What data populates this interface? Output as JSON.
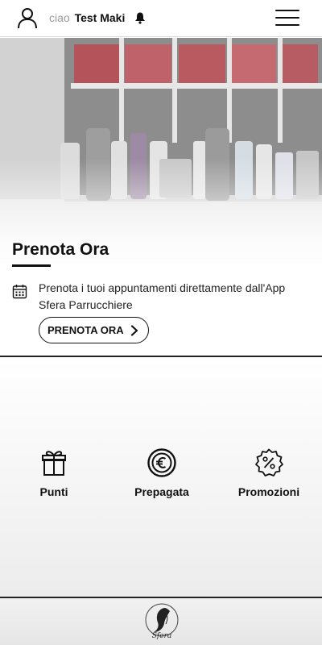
{
  "header": {
    "greeting": "ciao",
    "user_name": "Test Maki"
  },
  "hero": {
    "title": "Prenota Ora",
    "description": "Prenota i tuoi appuntamenti direttamente dall'App Sfera Parrucchiere",
    "button_label": "PRENOTA ORA"
  },
  "tiles": [
    {
      "label": "Punti",
      "icon": "gift-icon"
    },
    {
      "label": "Prepagata",
      "icon": "euro-coin-icon"
    },
    {
      "label": "Promozioni",
      "icon": "discount-badge-icon"
    }
  ],
  "footer": {
    "logo_text": "Sfera"
  }
}
